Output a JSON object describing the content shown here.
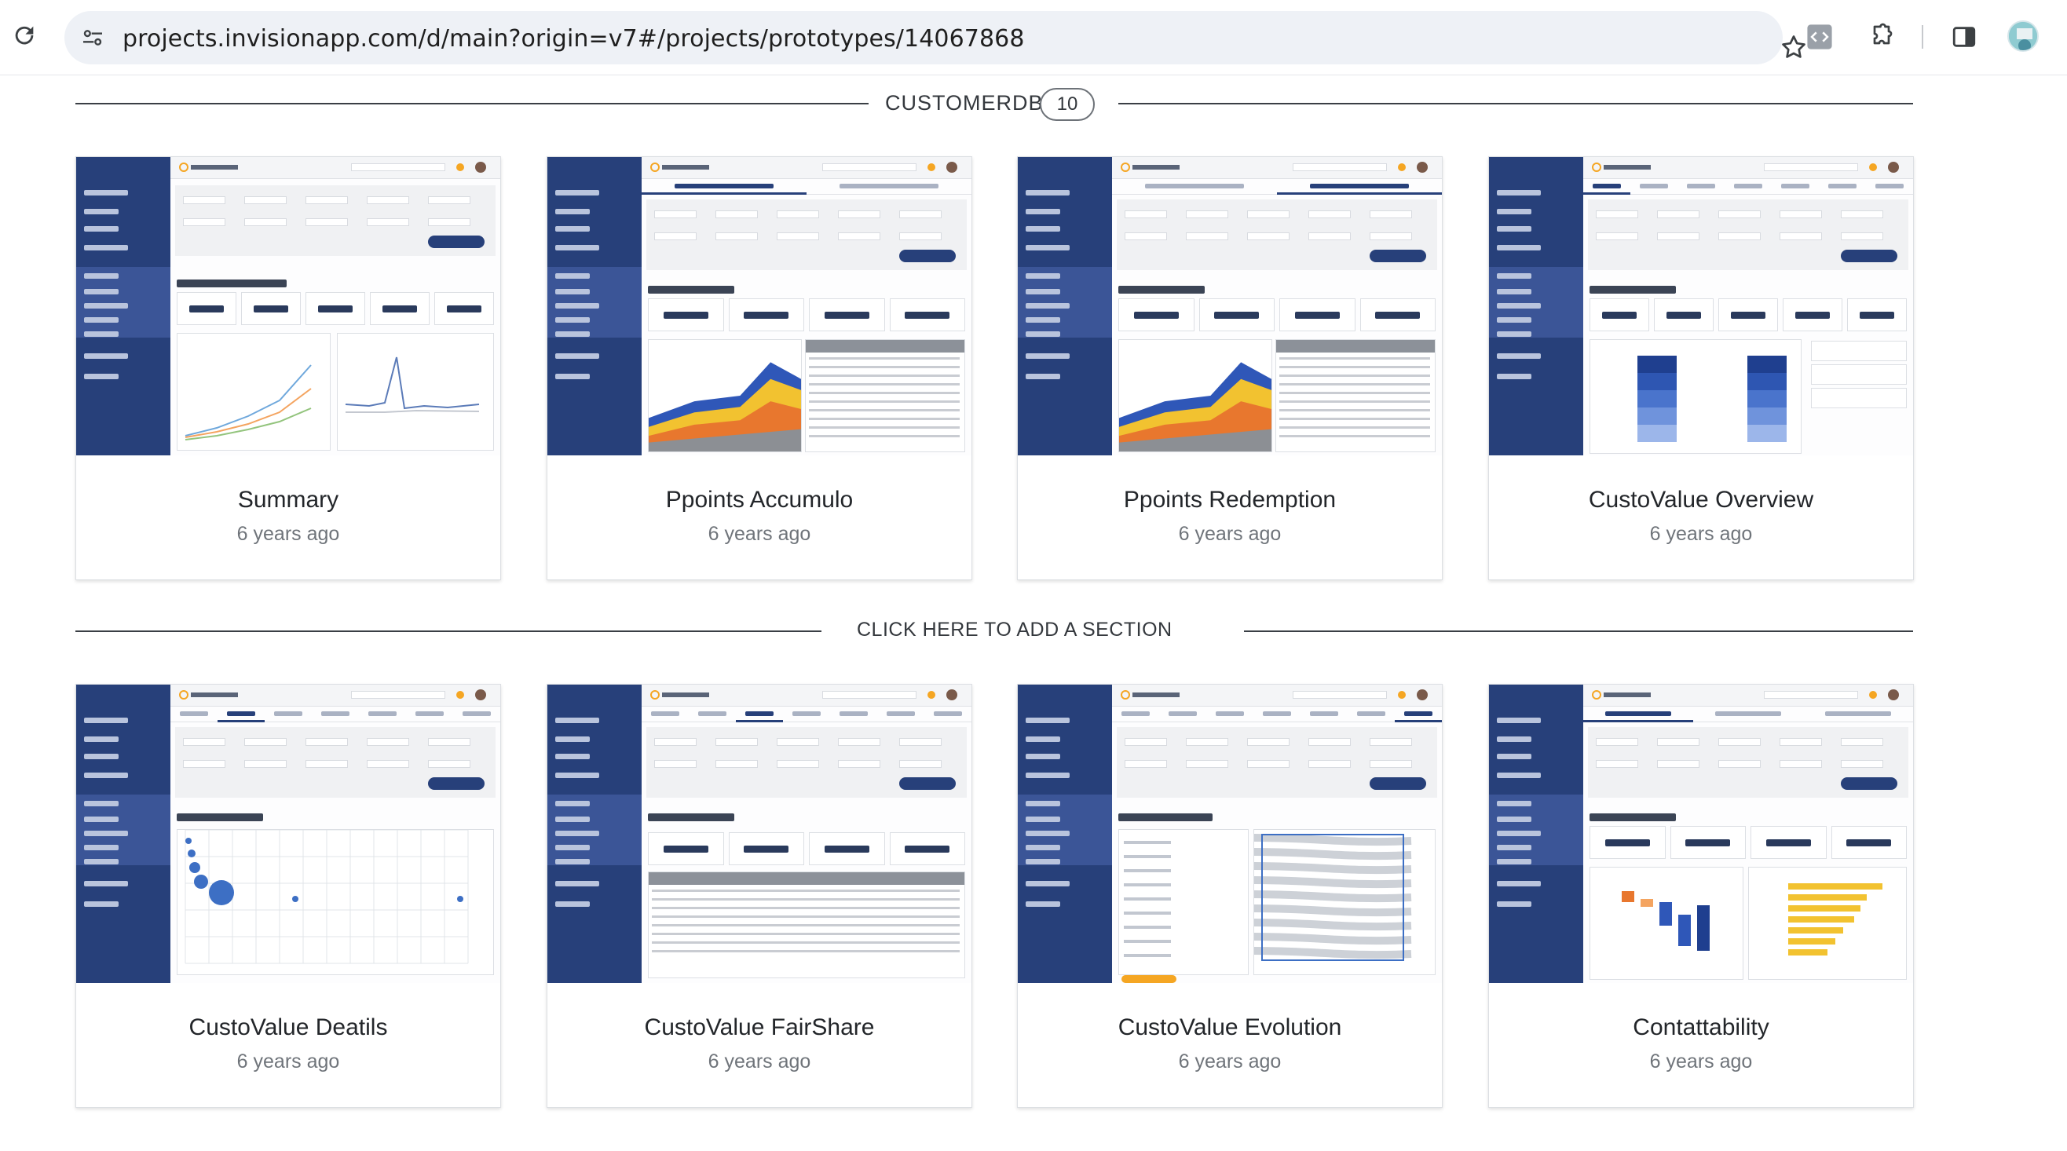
{
  "browser": {
    "url": "projects.invisionapp.com/d/main?origin=v7#/projects/prototypes/14067868"
  },
  "section": {
    "title": "CUSTOMERDB",
    "count": "10"
  },
  "add_section_label": "CLICK HERE TO ADD A SECTION",
  "cards_row1": [
    {
      "title": "Summary",
      "meta": "6 years ago"
    },
    {
      "title": "Ppoints Accumulo",
      "meta": "6 years ago"
    },
    {
      "title": "Ppoints Redemption",
      "meta": "6 years ago"
    },
    {
      "title": "CustoValue Overview",
      "meta": "6 years ago"
    }
  ],
  "cards_row2": [
    {
      "title": "CustoValue Deatils",
      "meta": "6 years ago"
    },
    {
      "title": "CustoValue FairShare",
      "meta": "6 years ago"
    },
    {
      "title": "CustoValue Evolution",
      "meta": "6 years ago"
    },
    {
      "title": "Contattability",
      "meta": "6 years ago"
    }
  ],
  "colors": {
    "sidebar_navy": "#27407a",
    "accent_orange": "#f5a623",
    "chart_blue": "#3d6fc4",
    "chart_yellow": "#f2c230"
  },
  "icons": {
    "reload": "reload-icon",
    "site_info": "site-info-icon",
    "bookmark": "star-icon",
    "extension": "puzzle-icon",
    "side_panel": "side-panel-icon"
  }
}
